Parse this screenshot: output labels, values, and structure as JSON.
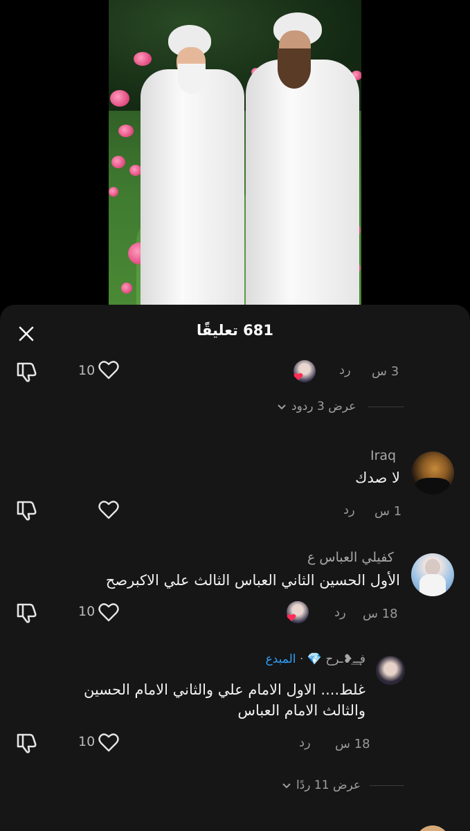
{
  "sheet": {
    "title": "681 تعليقًا"
  },
  "thread1": {
    "time": "3 س",
    "reply": "رد",
    "likes": "10",
    "view_replies": "عرض 3 ردود"
  },
  "comments": [
    {
      "username": "Iraq",
      "text": "لا صدك",
      "time": "1 س",
      "reply": "رد"
    },
    {
      "username": "كفيلي العباس ع",
      "text": "الأول الحسين الثاني العباس الثالث علي الاكبرصح",
      "time": "18 س",
      "reply": "رد",
      "likes": "10"
    },
    {
      "username": "فـ͢ـ❥ـرح",
      "badge": "المبدع",
      "text_line1": "غلط.... الاول الامام علي والثاني الامام الحسين",
      "text_line2": "والثالث الامام العباس",
      "time": "18 س",
      "reply": "رد",
      "likes": "10"
    }
  ],
  "thread_end": {
    "view_replies": "عرض 11 ردًا"
  },
  "colors": {
    "sheet_bg": "#161616",
    "accent_blue": "#2ea3ff",
    "heart_red": "#ff2d55",
    "muted": "#9a9a9a"
  },
  "icons": [
    "close-icon",
    "dislike-icon",
    "heart-icon",
    "chevron-down-icon",
    "diamond-icon"
  ]
}
